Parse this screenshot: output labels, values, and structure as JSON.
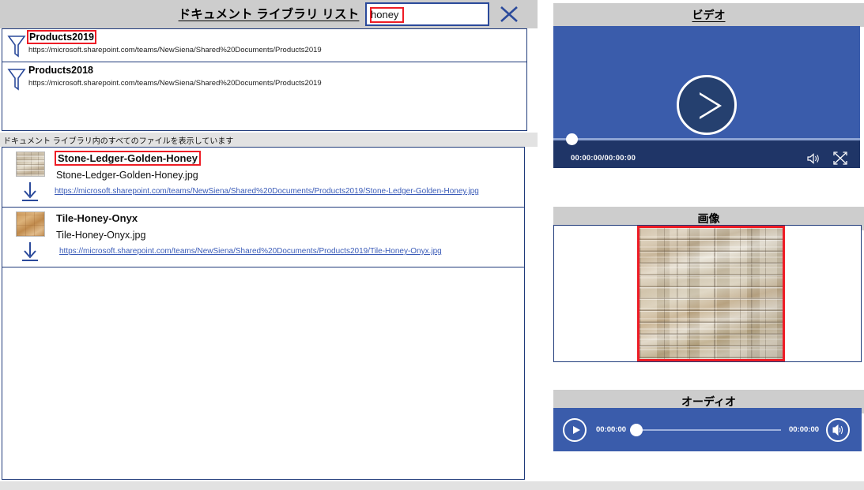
{
  "left_panel": {
    "title": "ドキュメント ライブラリ リスト",
    "search": {
      "value": "honey",
      "placeholder": ""
    },
    "close_icon": "close-x-icon",
    "libraries": [
      {
        "name": "Products2019",
        "url": "https://microsoft.sharepoint.com/teams/NewSiena/Shared%20Documents/Products2019",
        "icon": "funnel-filter-icon",
        "highlighted": true
      },
      {
        "name": "Products2018",
        "url": "https://microsoft.sharepoint.com/teams/NewSiena/Shared%20Documents/Products2019",
        "icon": "funnel-filter-icon",
        "highlighted": false
      }
    ],
    "status_text": "ドキュメント ライブラリ内のすべてのファイルを表示しています",
    "files": [
      {
        "title": "Stone-Ledger-Golden-Honey",
        "filename": "Stone-Ledger-Golden-Honey.jpg",
        "url": "https://microsoft.sharepoint.com/teams/NewSiena/Shared%20Documents/Products2019/Stone-Ledger-Golden-Honey.jpg",
        "thumb": "stone-ledger-thumbnail",
        "download_icon": "download-arrow-icon",
        "highlighted": true
      },
      {
        "title": "Tile-Honey-Onyx",
        "filename": "Tile-Honey-Onyx.jpg",
        "url": "https://microsoft.sharepoint.com/teams/NewSiena/Shared%20Documents/Products2019/Tile-Honey-Onyx.jpg",
        "thumb": "tile-honey-onyx-thumbnail",
        "download_icon": "download-arrow-icon",
        "highlighted": false
      }
    ]
  },
  "right_panel": {
    "video": {
      "heading": "ビデオ",
      "play_icon": "play-button-icon",
      "time": "00:00:00/00:00:00",
      "volume_icon": "volume-icon",
      "fullscreen_icon": "fullscreen-icon",
      "progress_percent": 0
    },
    "image": {
      "heading": "画像",
      "content": "stone-ledger-golden-honey-preview",
      "highlighted": true
    },
    "audio": {
      "heading": "オーディオ",
      "play_icon": "play-button-icon",
      "current_time": "00:00:00",
      "total_time": "00:00:00",
      "volume_icon": "volume-icon",
      "progress_percent": 0
    }
  },
  "colors": {
    "accent_blue": "#3a5cab",
    "dark_blue": "#1f3567",
    "border_blue": "#1f3a7a",
    "highlight_red": "#ee1c25",
    "header_gray": "#cdcdcd",
    "status_gray": "#e2e2e2",
    "link_blue": "#3a5bb8"
  }
}
